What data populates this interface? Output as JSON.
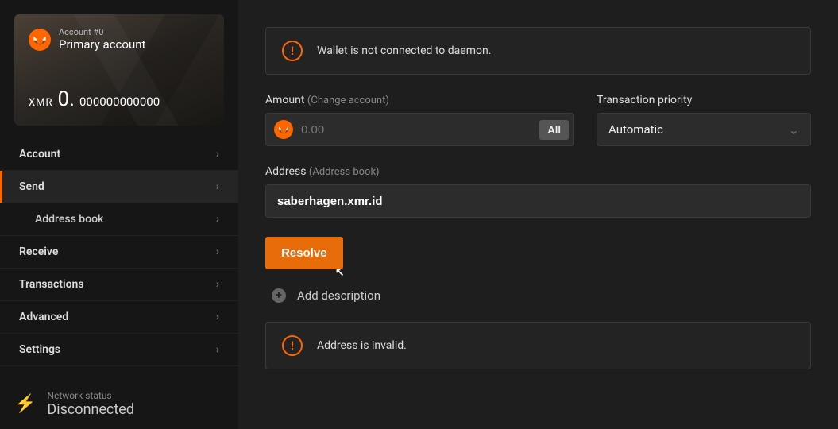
{
  "account": {
    "number_label": "Account #0",
    "name": "Primary account",
    "currency": "XMR",
    "balance_int": "0.",
    "balance_frac": "000000000000"
  },
  "nav": {
    "account": "Account",
    "send": "Send",
    "address_book": "Address book",
    "receive": "Receive",
    "transactions": "Transactions",
    "advanced": "Advanced",
    "settings": "Settings"
  },
  "network": {
    "label": "Network status",
    "status": "Disconnected"
  },
  "alerts": {
    "daemon": "Wallet is not connected to daemon.",
    "invalid_address": "Address is invalid."
  },
  "amount": {
    "label": "Amount",
    "hint": "(Change account)",
    "placeholder": "0.00",
    "all_button": "All"
  },
  "priority": {
    "label": "Transaction priority",
    "value": "Automatic"
  },
  "address": {
    "label": "Address",
    "hint": "(Address book)",
    "value": "saberhagen.xmr.id"
  },
  "buttons": {
    "resolve": "Resolve",
    "add_description": "Add description"
  }
}
